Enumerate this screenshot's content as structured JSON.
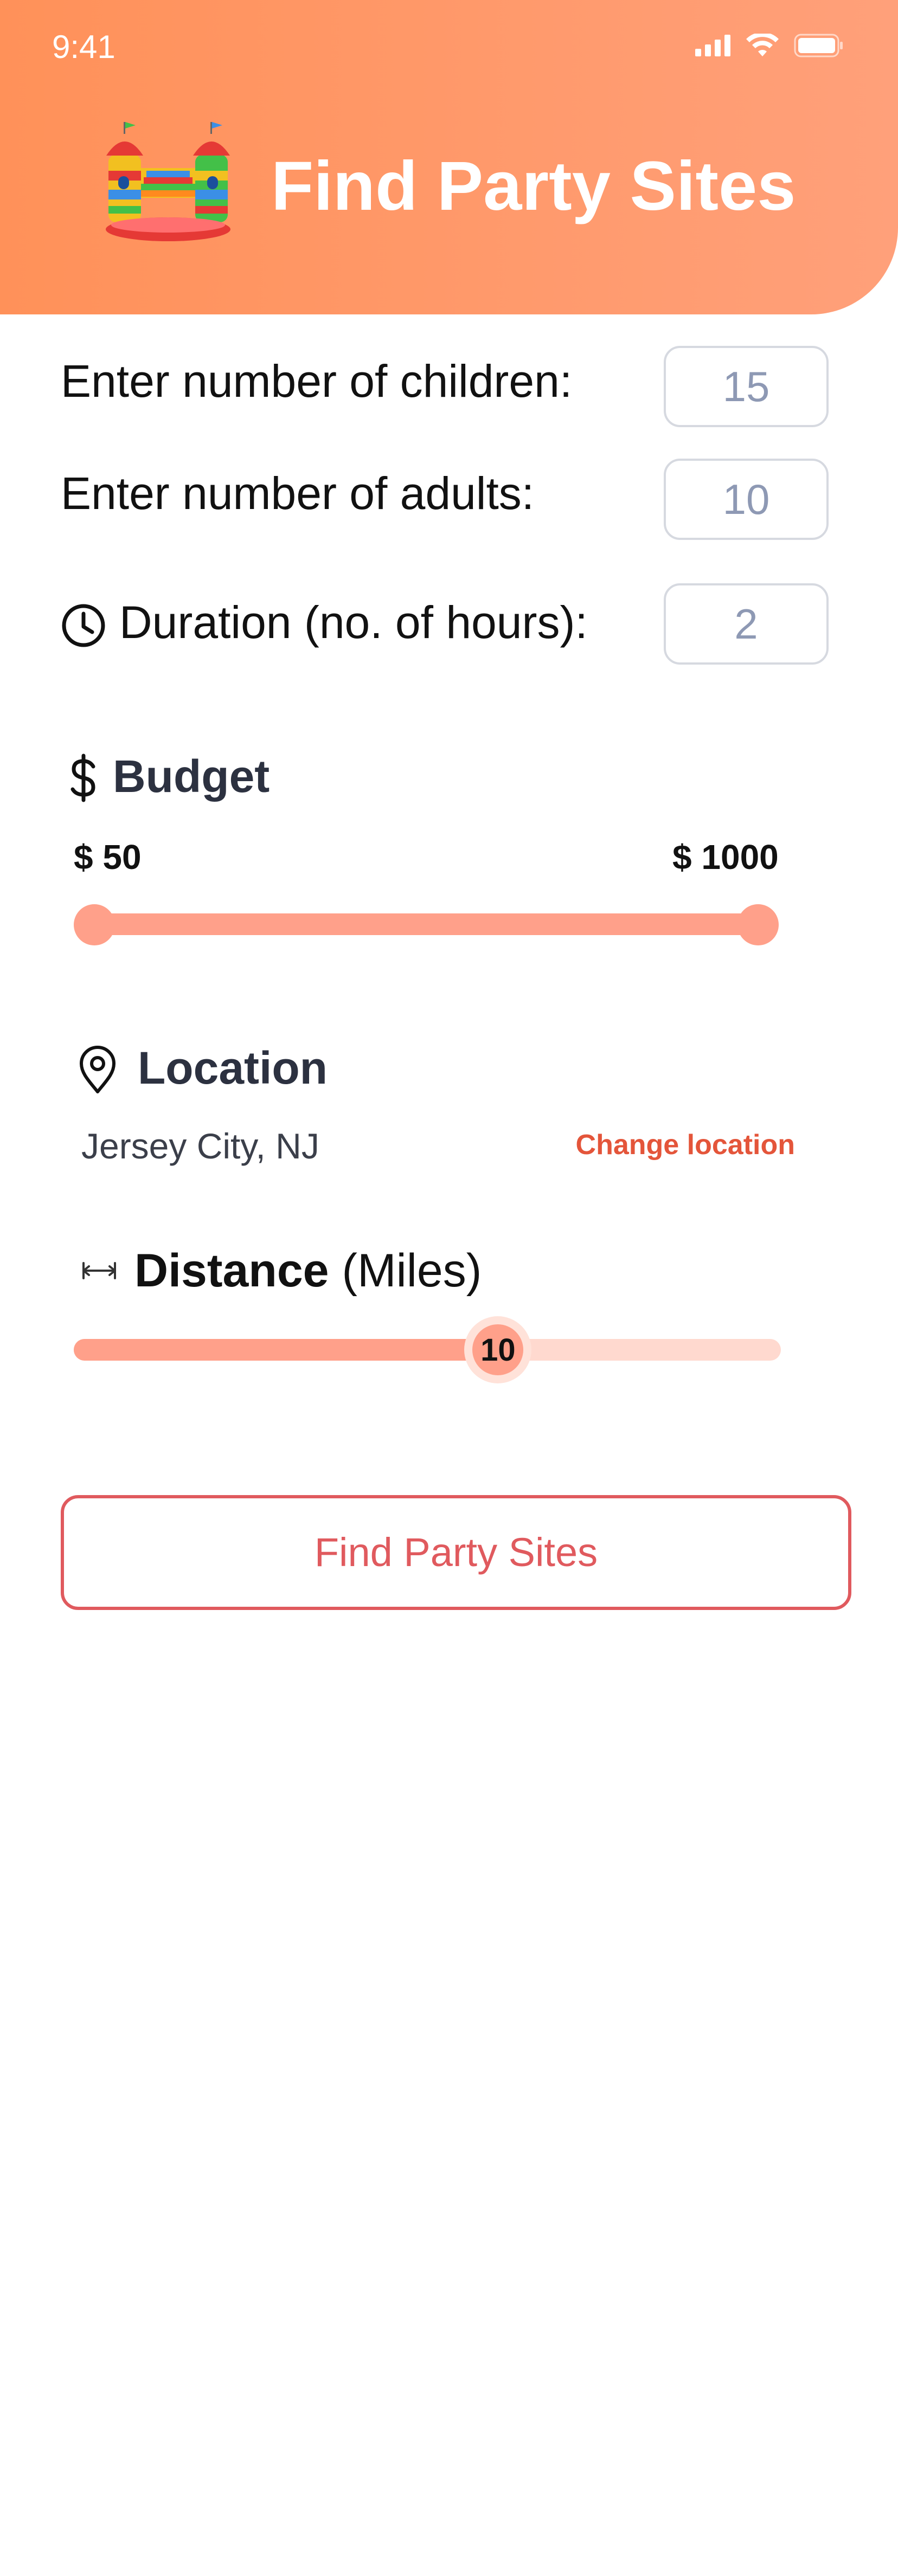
{
  "status_bar": {
    "time": "9:41"
  },
  "header": {
    "title": "Find Party Sites"
  },
  "form": {
    "children_label": "Enter number of children:",
    "children_value": "15",
    "adults_label": "Enter number of adults:",
    "adults_value": "10",
    "duration_label": "Duration (no. of hours):",
    "duration_value": "2"
  },
  "budget": {
    "title": "Budget",
    "min_label": "$ 50",
    "max_label": "$ 1000",
    "min_value": 50,
    "max_value": 1000
  },
  "location": {
    "title": "Location",
    "value": "Jersey City, NJ",
    "change_label": "Change location"
  },
  "distance": {
    "title": "Distance",
    "unit": "(Miles)",
    "value_label": "10",
    "fraction": 0.6
  },
  "find_button": {
    "label": "Find Party Sites"
  },
  "colors": {
    "accent": "#ff9159",
    "slider": "#ffa08a",
    "slider_light": "#ffd9cf",
    "button": "#e05a5e",
    "link": "#e4553a"
  }
}
